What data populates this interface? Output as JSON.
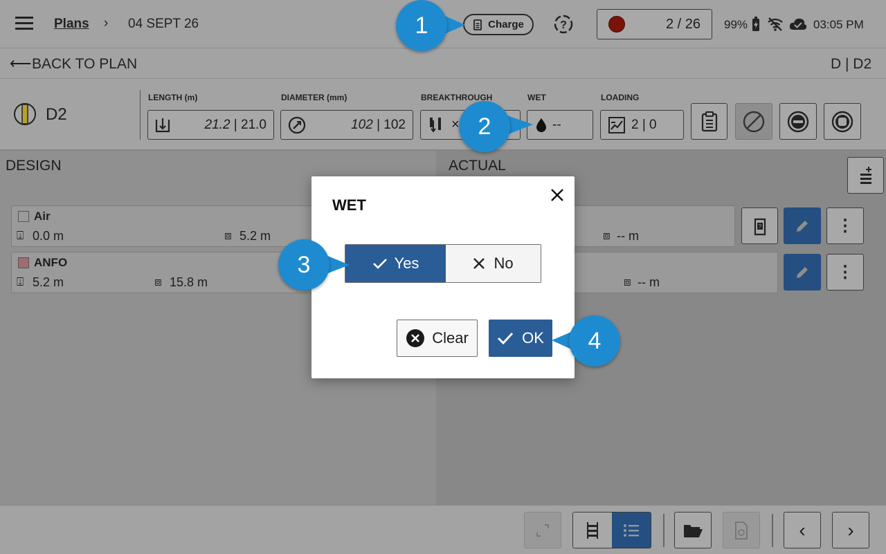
{
  "topbar": {
    "breadcrumb_root": "Plans",
    "breadcrumb_current": "04 SEPT 26",
    "charge_label": "Charge",
    "progress_text": "2 / 26",
    "battery": "99%",
    "time": "03:05 PM"
  },
  "backbar": {
    "back_label": "BACK TO PLAN",
    "hole_path": "D | D2"
  },
  "hole": {
    "name": "D2",
    "length_label": "LENGTH (m)",
    "length_value": "21.2",
    "length_actual": "| 21.0",
    "diameter_label": "DIAMETER (mm)",
    "diameter_value": "102",
    "diameter_actual": "| 102",
    "breakthrough_label": "BREAKTHROUGH",
    "wet_label": "WET",
    "wet_value": "--",
    "loading_label": "LOADING",
    "loading_value": "2 | 0"
  },
  "design": {
    "title": "DESIGN",
    "rows": [
      {
        "name": "Air",
        "from": "0.0 m",
        "to": "5.2 m",
        "color": "#9a9a9a"
      },
      {
        "name": "ANFO",
        "from": "5.2 m",
        "to": "15.8 m",
        "color": "#a06c74"
      }
    ]
  },
  "actual": {
    "title": "ACTUAL",
    "row1_to": "-- m",
    "row2_to": "-- m"
  },
  "dialog": {
    "title": "WET",
    "yes_label": "Yes",
    "no_label": "No",
    "clear_label": "Clear",
    "ok_label": "OK"
  },
  "callouts": [
    "1",
    "2",
    "3",
    "4"
  ],
  "colors": {
    "accent": "#2a5d96",
    "callout": "#1e8bd0",
    "record_dot": "#7a1408"
  }
}
